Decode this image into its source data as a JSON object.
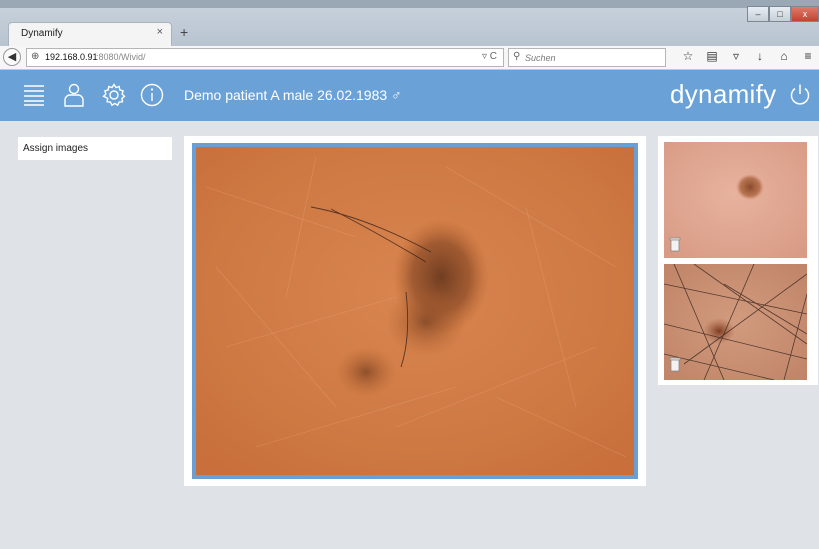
{
  "browser": {
    "tab_title": "Dynamify",
    "tab_close": "×",
    "new_tab": "+",
    "url_host": "192.168.0.91",
    "url_rest": ":8080/Wivid/",
    "search_placeholder": "Suchen",
    "window_buttons": [
      "–",
      "□",
      "x"
    ]
  },
  "header": {
    "patient_title": "Demo patient A male 26.02.1983 ♂",
    "brand": "dynamify"
  },
  "sidebar": {
    "assign_images_label": "Assign images"
  },
  "colors": {
    "header_bg": "#6aa1d6",
    "page_bg": "#dfe3e8",
    "selected_border": "#6a9fd5"
  },
  "icons": [
    "list-icon",
    "user-icon",
    "gear-icon",
    "info-icon",
    "power-icon",
    "trash-icon"
  ]
}
